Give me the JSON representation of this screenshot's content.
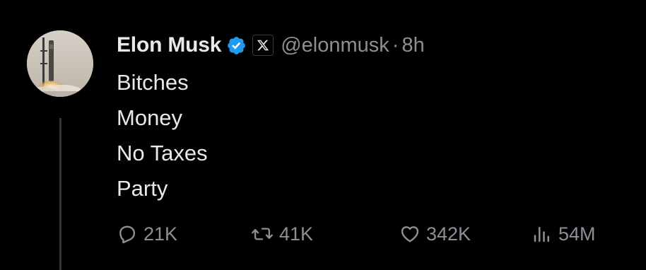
{
  "post": {
    "author_name": "Elon Musk",
    "handle": "@elonmusk",
    "separator": "·",
    "time": "8h",
    "lines": [
      "Bitches",
      "Money",
      "No Taxes",
      "Party"
    ]
  },
  "actions": {
    "replies": "21K",
    "reposts": "41K",
    "likes": "342K",
    "views": "54M"
  },
  "icons": {
    "verified": "verified-badge-icon",
    "x_logo": "x-logo-icon",
    "reply": "reply-icon",
    "repost": "repost-icon",
    "like": "heart-icon",
    "views": "views-chart-icon"
  },
  "colors": {
    "background": "#000000",
    "text_primary": "#e7e9ea",
    "text_secondary": "#8b9096",
    "verified_blue": "#1d9bf0",
    "thread_line": "#333639"
  }
}
